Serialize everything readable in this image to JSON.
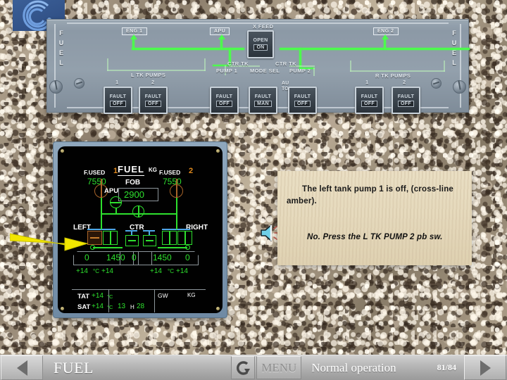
{
  "logo": {
    "name": "company-logo"
  },
  "overhead_panel": {
    "left_label": "FUEL",
    "right_label": "FUEL",
    "signal_boxes": {
      "eng1": "ENG 1",
      "apu": "APU",
      "eng2": "ENG 2"
    },
    "group_labels": {
      "l_tk_pumps": "L TK PUMPS",
      "r_tk_pumps": "R TK PUMPS",
      "ctr_tk_left": "CTR TK",
      "ctr_tk_right": "CTR TK",
      "x_feed": "X FEED"
    },
    "switch_numbers": {
      "l1": "1",
      "l2": "2",
      "r1": "1",
      "r2": "2"
    },
    "sub_labels": {
      "pump1": "PUMP 1",
      "mode_sel": "MODE SEL",
      "pump2": "PUMP 2",
      "auto": "AUTO"
    },
    "switches": [
      {
        "id": "l-tk-pump-1",
        "top": "FAULT",
        "bottom": "OFF"
      },
      {
        "id": "l-tk-pump-2",
        "top": "FAULT",
        "bottom": "OFF"
      },
      {
        "id": "x-feed",
        "top": "OPEN",
        "bottom": "ON"
      },
      {
        "id": "ctr-tk-pump-1",
        "top": "FAULT",
        "bottom": "OFF"
      },
      {
        "id": "ctr-tk-mode-sel",
        "top": "FAULT",
        "bottom": "MAN"
      },
      {
        "id": "ctr-tk-pump-2",
        "top": "FAULT",
        "bottom": "OFF"
      },
      {
        "id": "r-tk-pump-1",
        "top": "FAULT",
        "bottom": "OFF"
      },
      {
        "id": "r-tk-pump-2",
        "top": "FAULT",
        "bottom": "OFF"
      }
    ]
  },
  "ecam": {
    "title": "FUEL",
    "unit": "KG",
    "fob_label": "FOB",
    "fob_value": "2900",
    "f_used_label_left": "F.USED",
    "f_used_label_right": "F.USED",
    "eng1_num": "1",
    "eng2_num": "2",
    "f_used_1": "7550",
    "f_used_2": "7550",
    "apu_label": "APU",
    "left_label": "LEFT",
    "ctr_label": "CTR",
    "right_label": "RIGHT",
    "quantities": [
      "0",
      "1450",
      "0",
      "1450",
      "0"
    ],
    "temps": {
      "l_outer": "+14",
      "l_unit": "°C",
      "l_inner": "+14",
      "r_inner": "+14",
      "r_unit": "°C",
      "r_outer": "+14"
    },
    "tat_label": "TAT",
    "tat_value": "+14",
    "tat_unit": "°C",
    "sat_label": "SAT",
    "sat_value": "+14",
    "sat_unit": "°C",
    "clock_h": "13",
    "clock_sep": "H",
    "clock_m": "28",
    "gw_label": "GW",
    "gw_unit": "KG"
  },
  "message": {
    "line1": "The left tank pump 1 is off, (cross-line amber).",
    "line2": "No. Press  the L TK PUMP 2 pb sw."
  },
  "bottom_bar": {
    "prev_label": "previous-page",
    "next_label": "next-page",
    "title": "FUEL",
    "menu_label": "MENU",
    "status": "Normal operation",
    "page": "81/84"
  },
  "colors": {
    "flow_green": "#4dfb4d",
    "ecam_green": "#2ee02e",
    "ecam_amber": "#e08a1e",
    "pointer_yellow": "#f2e600",
    "panel_gray": "#93a0ac"
  }
}
